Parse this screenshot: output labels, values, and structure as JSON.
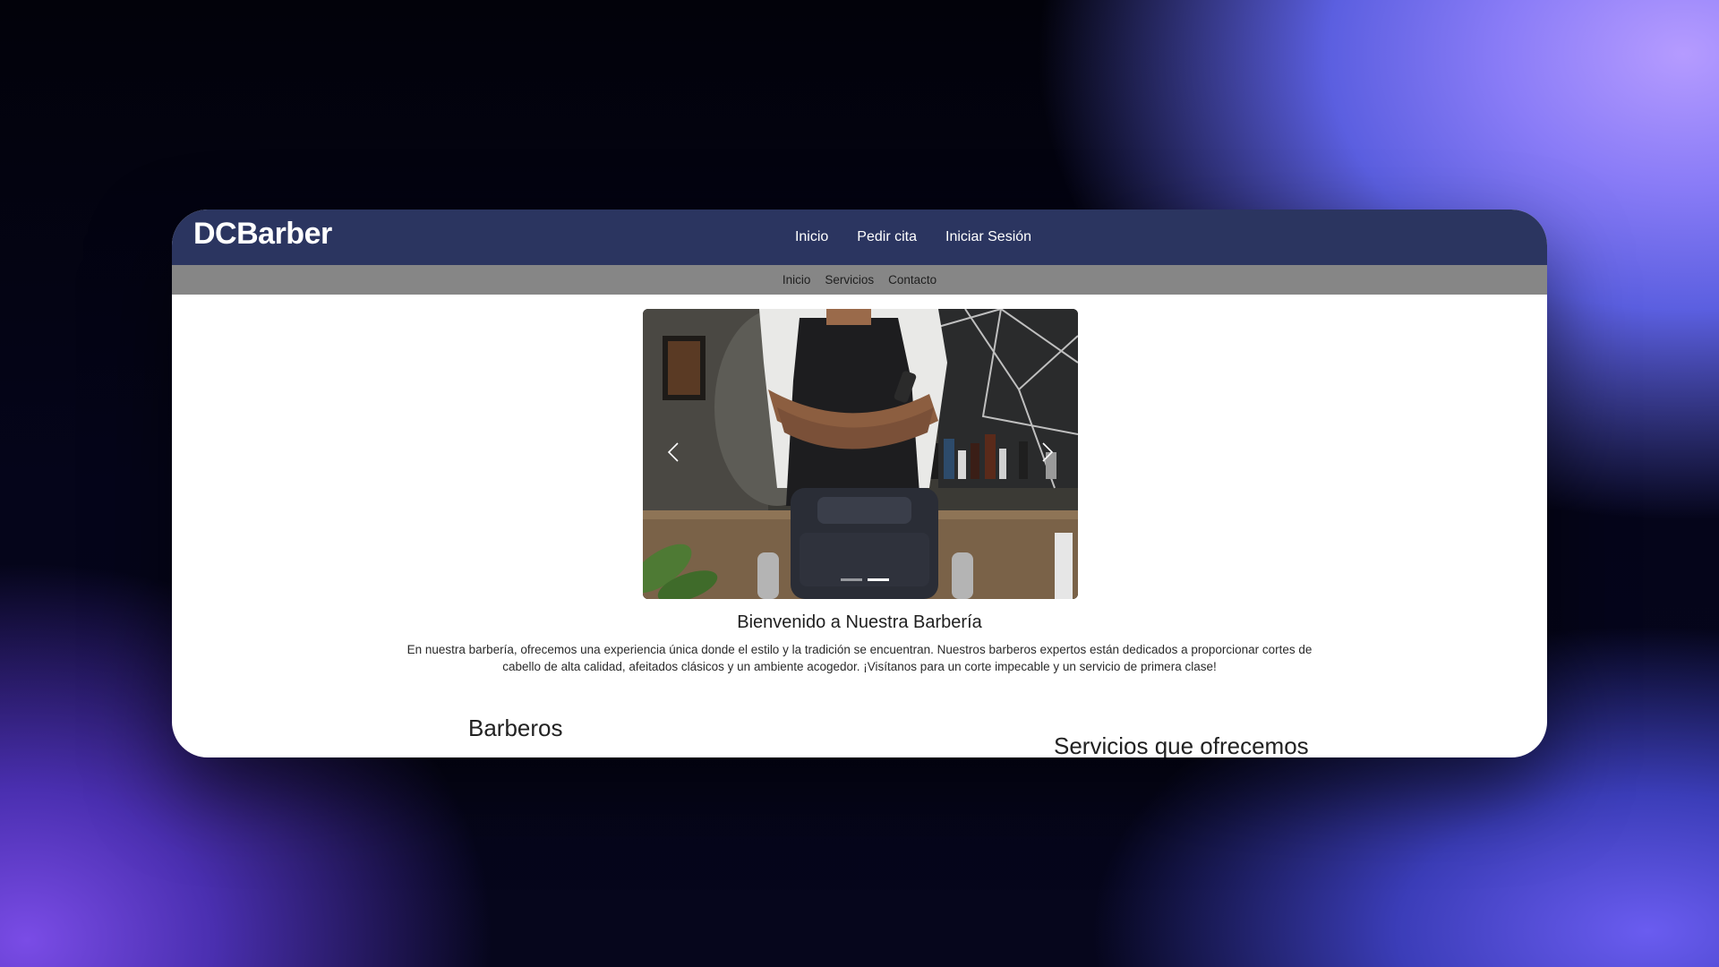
{
  "header": {
    "brand": "DCBarber",
    "nav": [
      "Inicio",
      "Pedir cita",
      "Iniciar Sesión"
    ]
  },
  "subnav": [
    "Inicio",
    "Servicios",
    "Contacto"
  ],
  "carousel": {
    "slide_count": 2,
    "active_slide": 2
  },
  "welcome": {
    "title": "Bienvenido a Nuestra Barbería",
    "text": "En nuestra barbería, ofrecemos una experiencia única donde el estilo y la tradición se encuentran. Nuestros barberos expertos están dedicados a proporcionar cortes de cabello de alta calidad, afeitados clásicos y un ambiente acogedor. ¡Visítanos para un corte impecable y un servicio de primera clase!"
  },
  "sections": {
    "barberos": "Barberos",
    "servicios": "Servicios que ofrecemos"
  },
  "colors": {
    "topbar": "#2b3560",
    "subbar": "#868686",
    "page_bg": "#ffffff"
  }
}
